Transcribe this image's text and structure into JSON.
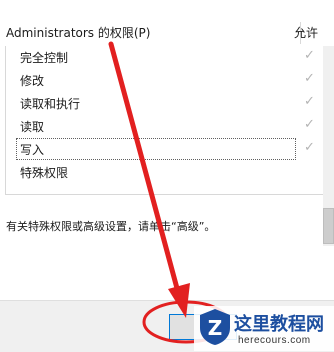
{
  "header": {
    "title": "Administrators 的权限(P)",
    "allow_label": "允许"
  },
  "permissions": [
    {
      "label": "完全控制",
      "allowed": true
    },
    {
      "label": "修改",
      "allowed": true
    },
    {
      "label": "读取和执行",
      "allowed": true
    },
    {
      "label": "读取",
      "allowed": true
    },
    {
      "label": "写入",
      "allowed": true,
      "focused": true
    },
    {
      "label": "特殊权限",
      "allowed": false
    }
  ],
  "check_glyph": "✓",
  "advanced_note": "有关特殊权限或高级设置，请单击“高级”。",
  "watermark": {
    "name": "这里教程网",
    "url": "herecours.com"
  },
  "colors": {
    "arrow": "#e22020",
    "focus_button_border": "#0078d7",
    "watermark_blue": "#1d4fa0"
  }
}
